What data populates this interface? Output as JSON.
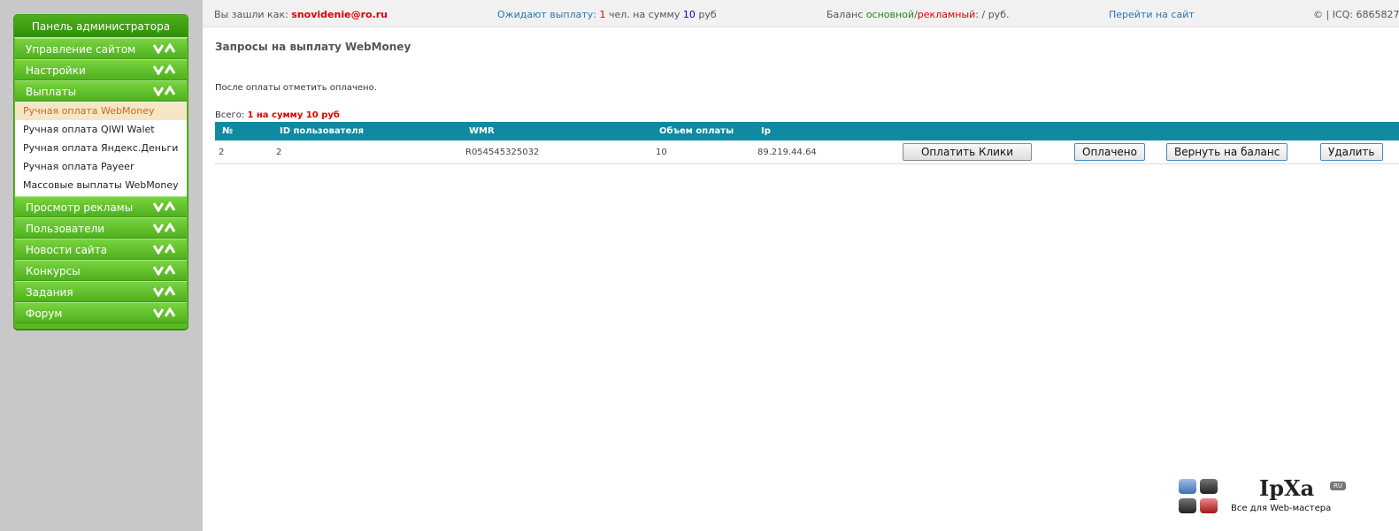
{
  "sidebar": {
    "title": "Панель администратора",
    "sections_before": [
      {
        "label": "Управление сайтом"
      },
      {
        "label": "Настройки"
      },
      {
        "label": "Выплаты"
      }
    ],
    "submenu": [
      {
        "label": "Ручная оплата WebMoney",
        "active": true
      },
      {
        "label": "Ручная оплата QIWI Walet"
      },
      {
        "label": "Ручная оплата Яндекс.Деньги"
      },
      {
        "label": "Ручная оплата Payeer"
      },
      {
        "label": "Массовые выплаты WebMoney"
      }
    ],
    "sections_after": [
      {
        "label": "Просмотр рекламы"
      },
      {
        "label": "Пользователи"
      },
      {
        "label": "Новости сайта"
      },
      {
        "label": "Конкурсы"
      },
      {
        "label": "Задания"
      },
      {
        "label": "Форум"
      }
    ]
  },
  "topbar": {
    "logged_prefix": "Вы зашли как:",
    "user": "snovidenie@ro.ru",
    "waiting_label": "Ожидают выплату:",
    "waiting_count": "1",
    "waiting_mid": "чел. на сумму",
    "waiting_sum": "10",
    "waiting_suffix": "руб",
    "balance_label": "Баланс",
    "balance_main": "основной",
    "balance_sep": "/",
    "balance_ad": "рекламный:",
    "balance_value": "/ руб.",
    "goto_site": "Перейти на сайт",
    "copyright": "© | ICQ: 6865827"
  },
  "main": {
    "title": "Запросы на выплату WebMoney",
    "note": "После оплаты отметить оплачено.",
    "total_label": "Всего:",
    "total_value": "1 на сумму 10 руб",
    "columns": [
      "№",
      "ID пользователя",
      "WMR",
      "Объем оплаты",
      "Ip"
    ],
    "rows": [
      {
        "num": "2",
        "user_id": "2",
        "wmr": "R054545325032",
        "amount": "10",
        "ip": "89.219.44.64"
      }
    ],
    "buttons": {
      "pay_clicks": "Оплатить Клики",
      "paid": "Оплачено",
      "return_balance": "Вернуть на баланс",
      "delete": "Удалить"
    }
  },
  "logo": {
    "name": "IpXa",
    "ru": "RU",
    "tagline": "Все для Web-мастера"
  }
}
